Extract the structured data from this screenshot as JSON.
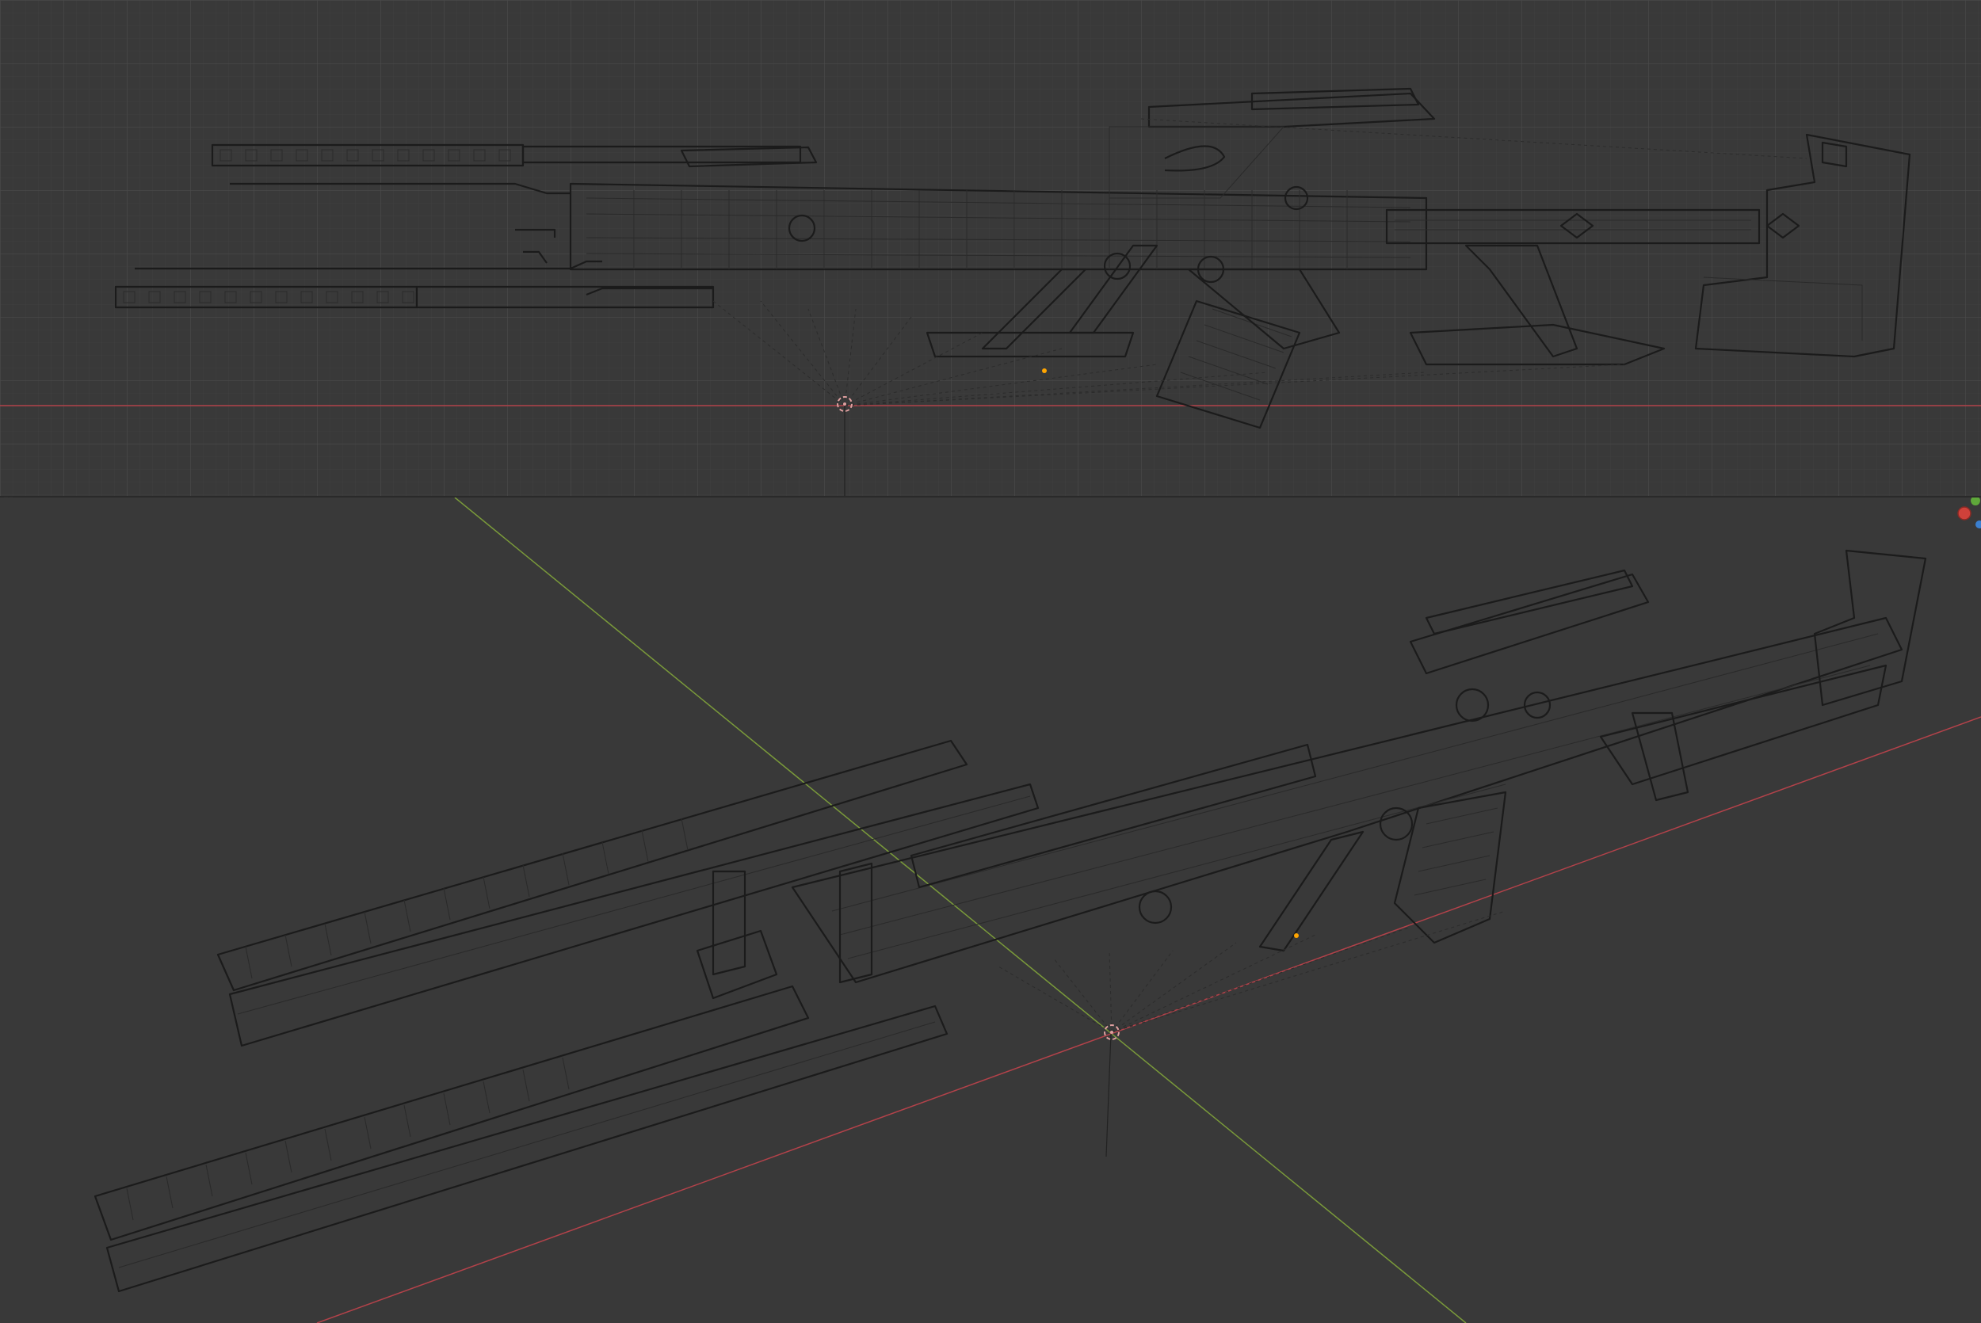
{
  "app": {
    "colors": {
      "viewport_bg": "#393939",
      "grid_minor": "#404040",
      "grid_major": "#4a4a4a",
      "axis_x": "#b3424a",
      "axis_y": "#7a9a3a",
      "wire": "#1b1b1b",
      "cursor": "#e0a0a0",
      "origin_dot": "#ffa500",
      "divider": "#2a2a2a",
      "gizmo_red": "#d0413a",
      "gizmo_green": "#5fa83a",
      "gizmo_blue": "#3a7fd0"
    }
  },
  "viewports": [
    {
      "id": "top",
      "view": "orthographic-side",
      "shows_grid": true,
      "icons": [
        "3d-cursor-icon",
        "origin-dot-icon"
      ]
    },
    {
      "id": "bottom",
      "view": "perspective",
      "shows_grid": false,
      "icons": [
        "3d-cursor-icon",
        "origin-dot-icon",
        "navigation-gizmo-icon"
      ]
    }
  ],
  "model": {
    "type": "wireframe",
    "subject": "rifle"
  }
}
